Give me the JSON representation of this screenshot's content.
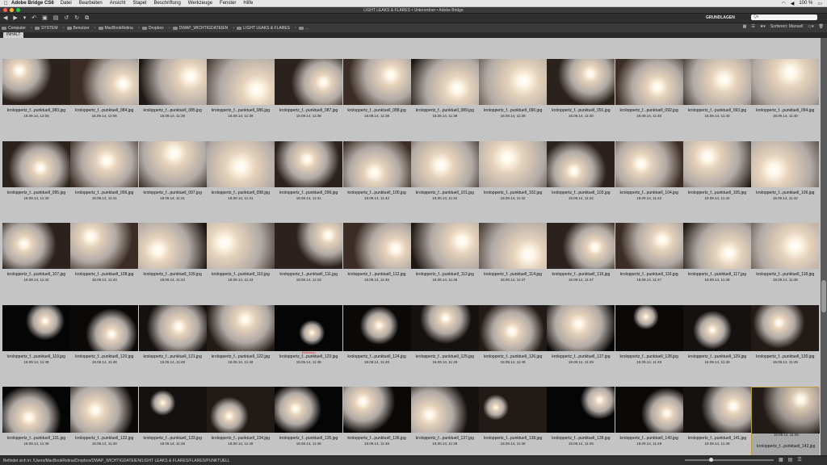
{
  "menubar": {
    "app_name": "Adobe Bridge CS6",
    "items": [
      "Datei",
      "Bearbeiten",
      "Ansicht",
      "Stapel",
      "Beschriftung",
      "Werkzeuge",
      "Fenster",
      "Hilfe"
    ],
    "battery": "100 %",
    "status_icons": [
      "wifi-icon",
      "volume-icon",
      "battery-icon"
    ]
  },
  "window": {
    "title": "LIGHT LEAKS & FLARES • Unterordner • Adobe Bridge",
    "traffic_colors": [
      "#ff5f57",
      "#febc2e",
      "#28c840"
    ]
  },
  "toolbar": {
    "workspace": "GRUNDLAGEN",
    "search_placeholder": "Q▾"
  },
  "breadcrumbs": [
    "Computer",
    "SYSTEM",
    "Benutzer",
    "MacBookRetina",
    "Dropbox",
    "DWAP_WICHTIGDATEIEN",
    "LIGHT LEAKS & FLARES",
    "..."
  ],
  "sort_label": "Sortieren: Manuell",
  "panel_tab": "INHALT",
  "thumbnails": [
    {
      "name": "kroloppertz_f...punktuell_083.jpg",
      "date": "18.09.14, 12:05"
    },
    {
      "name": "kroloppertz_f...punktuell_084.jpg",
      "date": "18.09.14, 12:06"
    },
    {
      "name": "kroloppertz_f...punktuell_085.jpg",
      "date": "18.09.14, 11:39"
    },
    {
      "name": "kroloppertz_f...punktuell_086.jpg",
      "date": "18.09.14, 11:39"
    },
    {
      "name": "kroloppertz_f...punktuell_087.jpg",
      "date": "18.09.14, 11:39"
    },
    {
      "name": "kroloppertz_f...punktuell_088.jpg",
      "date": "18.09.14, 11:39"
    },
    {
      "name": "kroloppertz_f...punktuell_089.jpg",
      "date": "18.09.14, 11:39"
    },
    {
      "name": "kroloppertz_f...punktuell_090.jpg",
      "date": "18.09.14, 11:39"
    },
    {
      "name": "kroloppertz_f...punktuell_091.jpg",
      "date": "18.09.14, 11:40"
    },
    {
      "name": "kroloppertz_f...punktuell_092.jpg",
      "date": "18.09.14, 11:40"
    },
    {
      "name": "kroloppertz_f...punktuell_093.jpg",
      "date": "18.09.14, 11:40"
    },
    {
      "name": "kroloppertz_f...punktuell_094.jpg",
      "date": "18.09.14, 11:40"
    },
    {
      "name": "kroloppertz_f...punktuell_095.jpg",
      "date": "18.09.14, 11:40"
    },
    {
      "name": "kroloppertz_f...punktuell_096.jpg",
      "date": "18.09.14, 11:41"
    },
    {
      "name": "kroloppertz_f...punktuell_097.jpg",
      "date": "18.09.14, 11:41"
    },
    {
      "name": "kroloppertz_f...punktuell_098.jpg",
      "date": "18.09.14, 11:41"
    },
    {
      "name": "kroloppertz_f...punktuell_099.jpg",
      "date": "18.09.14, 11:41"
    },
    {
      "name": "kroloppertz_f...punktuell_100.jpg",
      "date": "18.09.14, 11:42"
    },
    {
      "name": "kroloppertz_f...punktuell_101.jpg",
      "date": "18.09.14, 11:42"
    },
    {
      "name": "kroloppertz_f...punktuell_102.jpg",
      "date": "18.09.14, 11:42"
    },
    {
      "name": "kroloppertz_f...punktuell_103.jpg",
      "date": "18.09.14, 11:42"
    },
    {
      "name": "kroloppertz_f...punktuell_104.jpg",
      "date": "18.09.14, 11:42"
    },
    {
      "name": "kroloppertz_f...punktuell_105.jpg",
      "date": "18.09.14, 11:42"
    },
    {
      "name": "kroloppertz_f...punktuell_106.jpg",
      "date": "18.09.14, 11:42"
    },
    {
      "name": "kroloppertz_f...punktuell_107.jpg",
      "date": "18.09.14, 11:42"
    },
    {
      "name": "kroloppertz_f...punktuell_108.jpg",
      "date": "18.09.14, 11:43"
    },
    {
      "name": "kroloppertz_f...punktuell_109.jpg",
      "date": "18.09.14, 11:43"
    },
    {
      "name": "kroloppertz_f...punktuell_110.jpg",
      "date": "18.09.14, 11:43"
    },
    {
      "name": "kroloppertz_f...punktuell_111.jpg",
      "date": "18.09.14, 11:43"
    },
    {
      "name": "kroloppertz_f...punktuell_112.jpg",
      "date": "18.09.14, 11:45"
    },
    {
      "name": "kroloppertz_f...punktuell_113.jpg",
      "date": "18.09.14, 11:46"
    },
    {
      "name": "kroloppertz_f...punktuell_114.jpg",
      "date": "18.09.14, 11:47"
    },
    {
      "name": "kroloppertz_f...punktuell_115.jpg",
      "date": "18.09.14, 11:47"
    },
    {
      "name": "kroloppertz_f...punktuell_116.jpg",
      "date": "18.09.14, 11:47"
    },
    {
      "name": "kroloppertz_f...punktuell_117.jpg",
      "date": "18.09.14, 11:48"
    },
    {
      "name": "kroloppertz_f...punktuell_118.jpg",
      "date": "18.09.14, 11:48"
    },
    {
      "name": "kroloppertz_f...punktuell_119.jpg",
      "date": "18.09.14, 11:48"
    },
    {
      "name": "kroloppertz_f...punktuell_120.jpg",
      "date": "18.09.14, 11:48"
    },
    {
      "name": "kroloppertz_f...punktuell_121.jpg",
      "date": "18.09.14, 11:48"
    },
    {
      "name": "kroloppertz_f...punktuell_122.jpg",
      "date": "18.09.14, 11:48"
    },
    {
      "name": "kroloppertz_f...punktuell_123.jpg",
      "date": "18.09.14, 11:48",
      "label": "Ablehnen"
    },
    {
      "name": "kroloppertz_f...punktuell_124.jpg",
      "date": "18.09.14, 11:49"
    },
    {
      "name": "kroloppertz_f...punktuell_125.jpg",
      "date": "18.09.14, 11:49"
    },
    {
      "name": "kroloppertz_f...punktuell_126.jpg",
      "date": "18.09.14, 11:49"
    },
    {
      "name": "kroloppertz_f...punktuell_127.jpg",
      "date": "18.09.14, 11:49"
    },
    {
      "name": "kroloppertz_f...punktuell_128.jpg",
      "date": "18.09.14, 11:49"
    },
    {
      "name": "kroloppertz_f...punktuell_129.jpg",
      "date": "18.09.14, 11:49"
    },
    {
      "name": "kroloppertz_f...punktuell_130.jpg",
      "date": "18.09.14, 11:49"
    },
    {
      "name": "kroloppertz_f...punktuell_131.jpg",
      "date": "18.09.14, 11:49"
    },
    {
      "name": "kroloppertz_f...punktuell_132.jpg",
      "date": "18.09.14, 11:49"
    },
    {
      "name": "kroloppertz_f...punktuell_133.jpg",
      "date": "18.09.14, 11:49"
    },
    {
      "name": "kroloppertz_f...punktuell_134.jpg",
      "date": "18.09.14, 11:49"
    },
    {
      "name": "kroloppertz_f...punktuell_135.jpg",
      "date": "18.09.14, 11:49"
    },
    {
      "name": "kroloppertz_f...punktuell_136.jpg",
      "date": "18.09.14, 11:49"
    },
    {
      "name": "kroloppertz_f...punktuell_137.jpg",
      "date": "18.09.14, 11:49"
    },
    {
      "name": "kroloppertz_f...punktuell_138.jpg",
      "date": "18.09.14, 11:49"
    },
    {
      "name": "kroloppertz_f...punktuell_139.jpg",
      "date": "18.09.14, 11:49"
    },
    {
      "name": "kroloppertz_f...punktuell_140.jpg",
      "date": "18.09.14, 11:49"
    },
    {
      "name": "kroloppertz_f...punktuell_141.jpg",
      "date": "18.09.14, 11:49"
    },
    {
      "name": "kroloppertz_f...punktuell_142.jpg",
      "date": "18.09.14, 11:49",
      "selected": true,
      "rating": "· · · · ·"
    }
  ],
  "status": {
    "path": "Befindet sich in: /Users/MacBookRetina/Dropbox/DWAP_WICHTIGDATEIEN/LIGHT LEAKS & FLARES/FLARES/PUNKTUELL"
  }
}
